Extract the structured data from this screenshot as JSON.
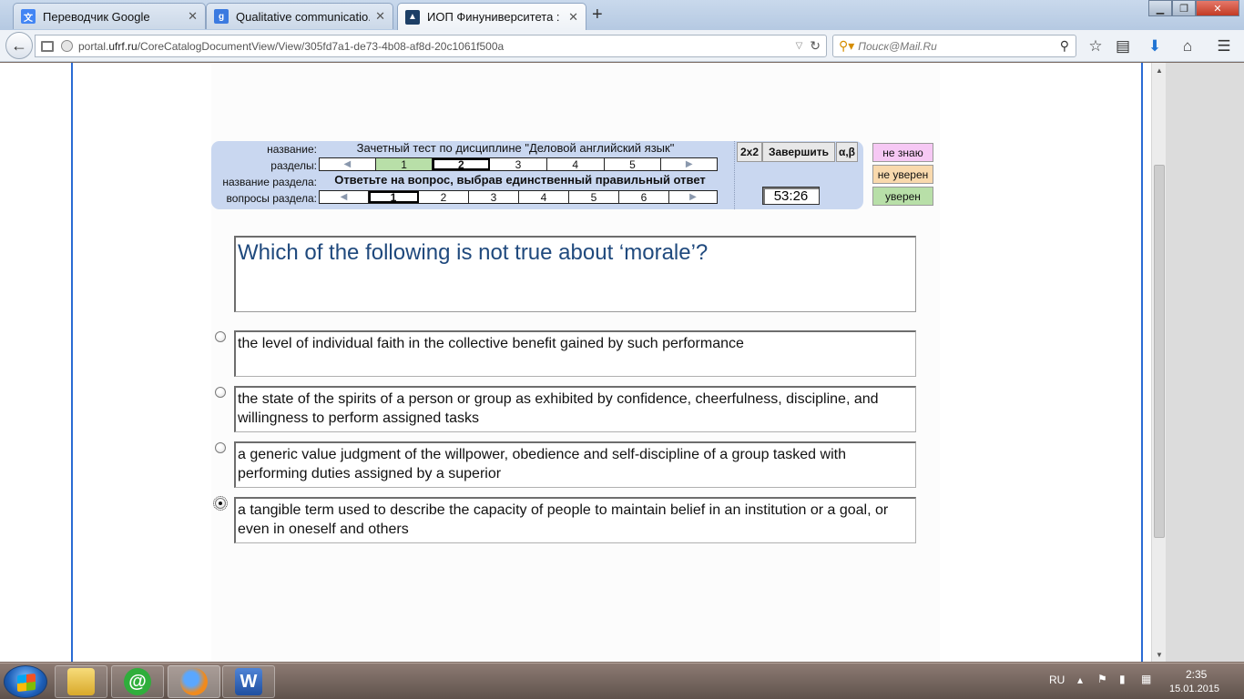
{
  "browser": {
    "tabs": [
      {
        "label": "Переводчик Google",
        "favicon": "translate-icon",
        "active": false
      },
      {
        "label": "Qualitative communicatio...",
        "favicon": "google-icon",
        "active": false
      },
      {
        "label": "ИОП Финуниверситета : ...",
        "favicon": "graduation-cap-icon",
        "active": true
      }
    ],
    "url_prefix": "portal.",
    "url_host": "ufrf.ru",
    "url_path": "/CoreCatalogDocumentView/View/305fd7a1-de73-4b08-af8d-20c1061f500a",
    "search_placeholder": "Поиск@Mail.Ru"
  },
  "test": {
    "labels": {
      "name": "название:",
      "sections": "разделы:",
      "section_name": "название раздела:",
      "section_questions": "вопросы раздела:"
    },
    "title": "Зачетный тест по дисциплине \"Деловой английский язык\"",
    "sections": [
      "1",
      "2",
      "3",
      "4",
      "5"
    ],
    "instruction": "Ответьте на вопрос, выбрав единственный правильный ответ",
    "questions": [
      "1",
      "2",
      "3",
      "4",
      "5",
      "6"
    ],
    "buttons": {
      "calc": "2x2",
      "finish": "Завершить",
      "symbols": "α,β"
    },
    "timer": "53:26",
    "confidence": {
      "dont_know": "не знаю",
      "not_sure": "не уверен",
      "sure": "уверен"
    }
  },
  "question": {
    "text": "Which of the following is not true about ‘morale’?",
    "answers": [
      {
        "text": "the level of individual faith in the collective benefit gained by such performance",
        "selected": false
      },
      {
        "text": "the state of the spirits of a person or group as exhibited by confidence, cheerfulness, discipline, and willingness to perform assigned tasks",
        "selected": false
      },
      {
        "text": "a generic value judgment of the willpower, obedience and self-discipline of a group tasked with performing duties assigned by a superior",
        "selected": false
      },
      {
        "text": "a tangible term used to describe the capacity of people to maintain belief in an institution or a goal, or even in oneself and others",
        "selected": true
      }
    ]
  },
  "taskbar": {
    "lang": "RU",
    "time": "2:35",
    "date": "15.01.2015",
    "word_letter": "W"
  },
  "colors": {
    "question_text": "#1f497d",
    "panel_bg": "#c9d7f0",
    "done_section": "#b8dfa8",
    "dont_know": "#f6c8f4",
    "not_sure": "#f9d9ad",
    "sure": "#b8dfa8"
  }
}
